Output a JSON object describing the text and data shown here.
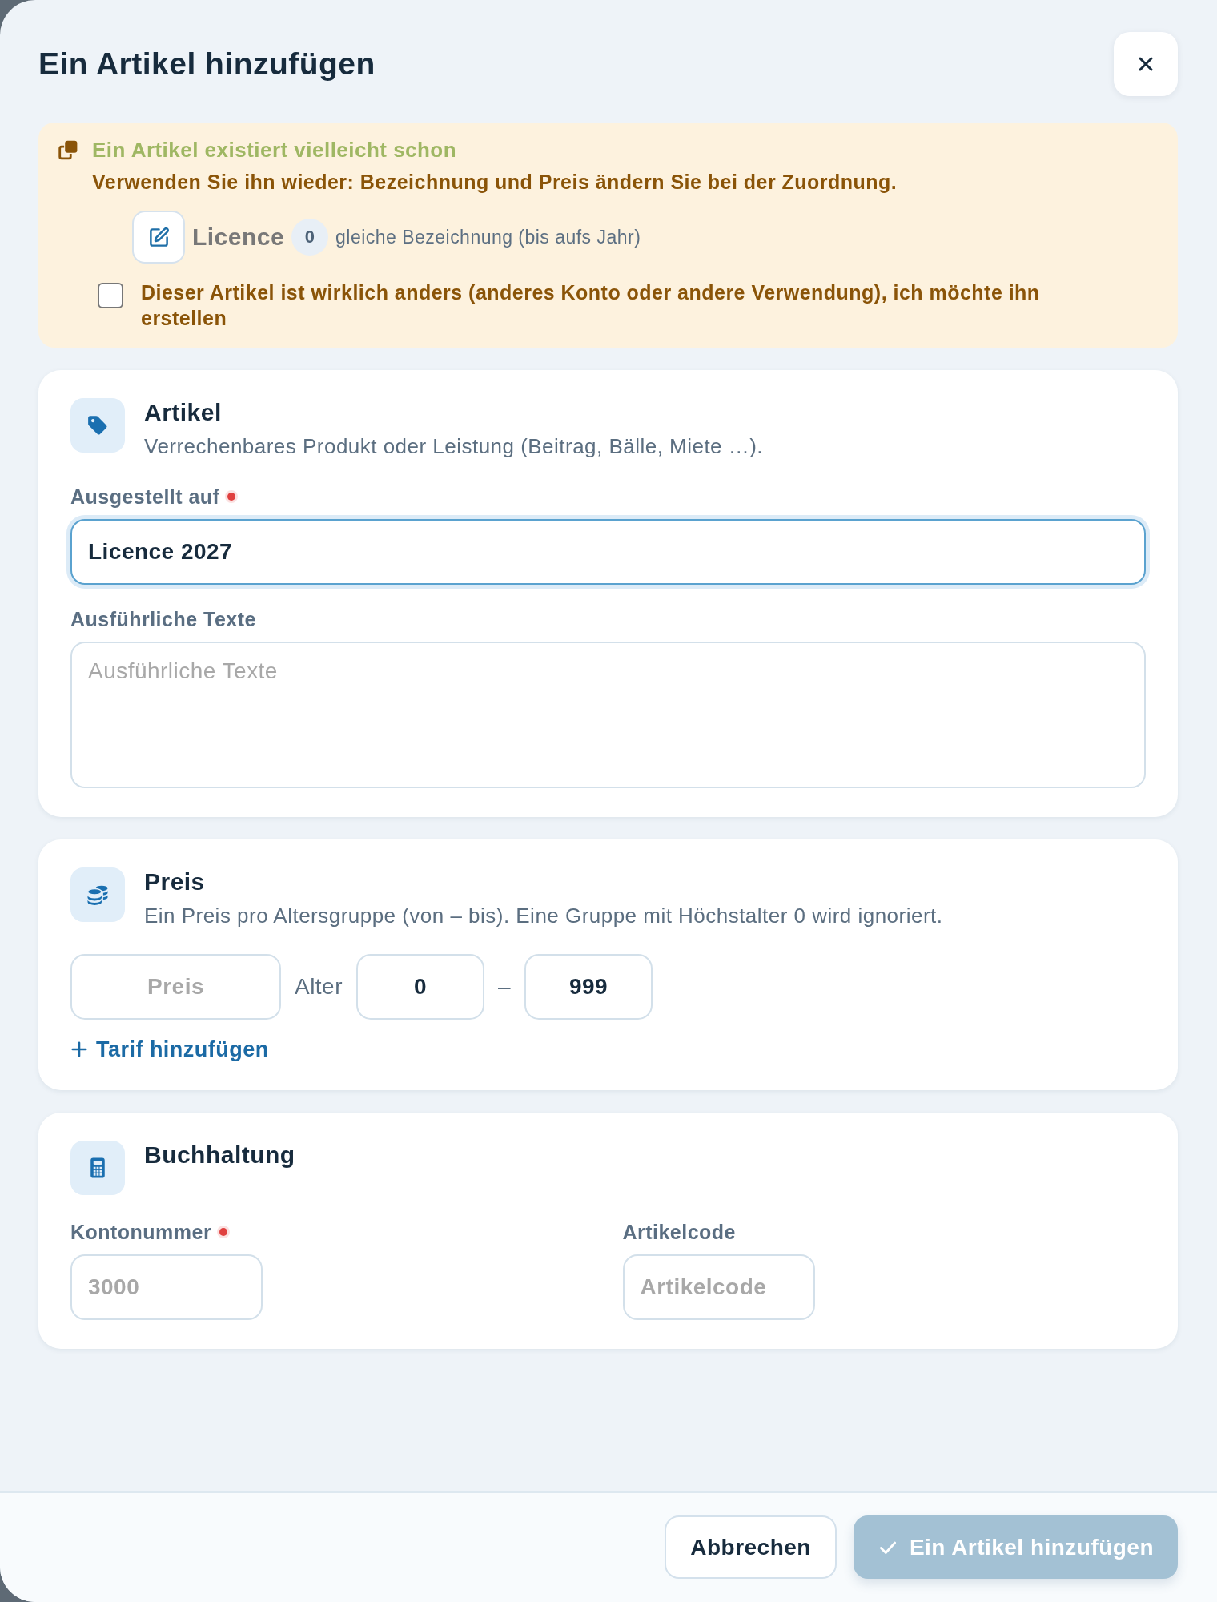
{
  "dialog": {
    "title": "Ein Artikel hinzufügen"
  },
  "notice": {
    "title": "Ein Artikel existiert vielleicht schon",
    "message": "Verwenden Sie ihn wieder: Bezeichnung und Preis ändern Sie bei der Zuordnung.",
    "match": {
      "name": "Licence",
      "count": "0",
      "note": "gleiche Bezeichnung (bis aufs Jahr)"
    },
    "confirm": {
      "label": "Dieser Artikel ist wirklich anders (anderes Konto oder andere Verwendung), ich möchte ihn erstellen",
      "checked": false
    }
  },
  "sections": [
    {
      "kind": "article",
      "title": "Artikel",
      "subtitle": "Verrechenbares Produkt oder Leistung (Beitrag, Bälle, Miete …).",
      "fields": [
        {
          "kind": "text",
          "label": "Ausgestellt auf",
          "required": true,
          "value": "Licence 2027",
          "focused": true
        },
        {
          "kind": "textarea",
          "label": "Ausführliche Texte",
          "required": false,
          "placeholder": "Ausführliche Texte",
          "focused": false
        }
      ]
    },
    {
      "kind": "price",
      "title": "Preis",
      "subtitle": "Ein Preis pro Altersgruppe (von – bis). Eine Gruppe mit Höchstalter 0 wird ignoriert.",
      "tiers": [
        {
          "price_placeholder": "Preis",
          "age_label": "Alter",
          "age_from": "0",
          "separator": "–",
          "age_to": "999"
        }
      ],
      "add_label": "Tarif hinzufügen"
    },
    {
      "kind": "accounting",
      "title": "Buchhaltung",
      "fields": [
        {
          "kind": "text",
          "label": "Kontonummer",
          "required": true,
          "placeholder": "3000",
          "focused": false
        },
        {
          "kind": "text",
          "label": "Artikelcode",
          "required": false,
          "placeholder": "Artikelcode",
          "focused": false
        }
      ]
    }
  ],
  "footer": {
    "buttons": [
      {
        "kind": "secondary",
        "label": "Abbrechen",
        "disabled": false
      },
      {
        "kind": "primary",
        "label": "Ein Artikel hinzufügen",
        "disabled": true
      }
    ]
  }
}
